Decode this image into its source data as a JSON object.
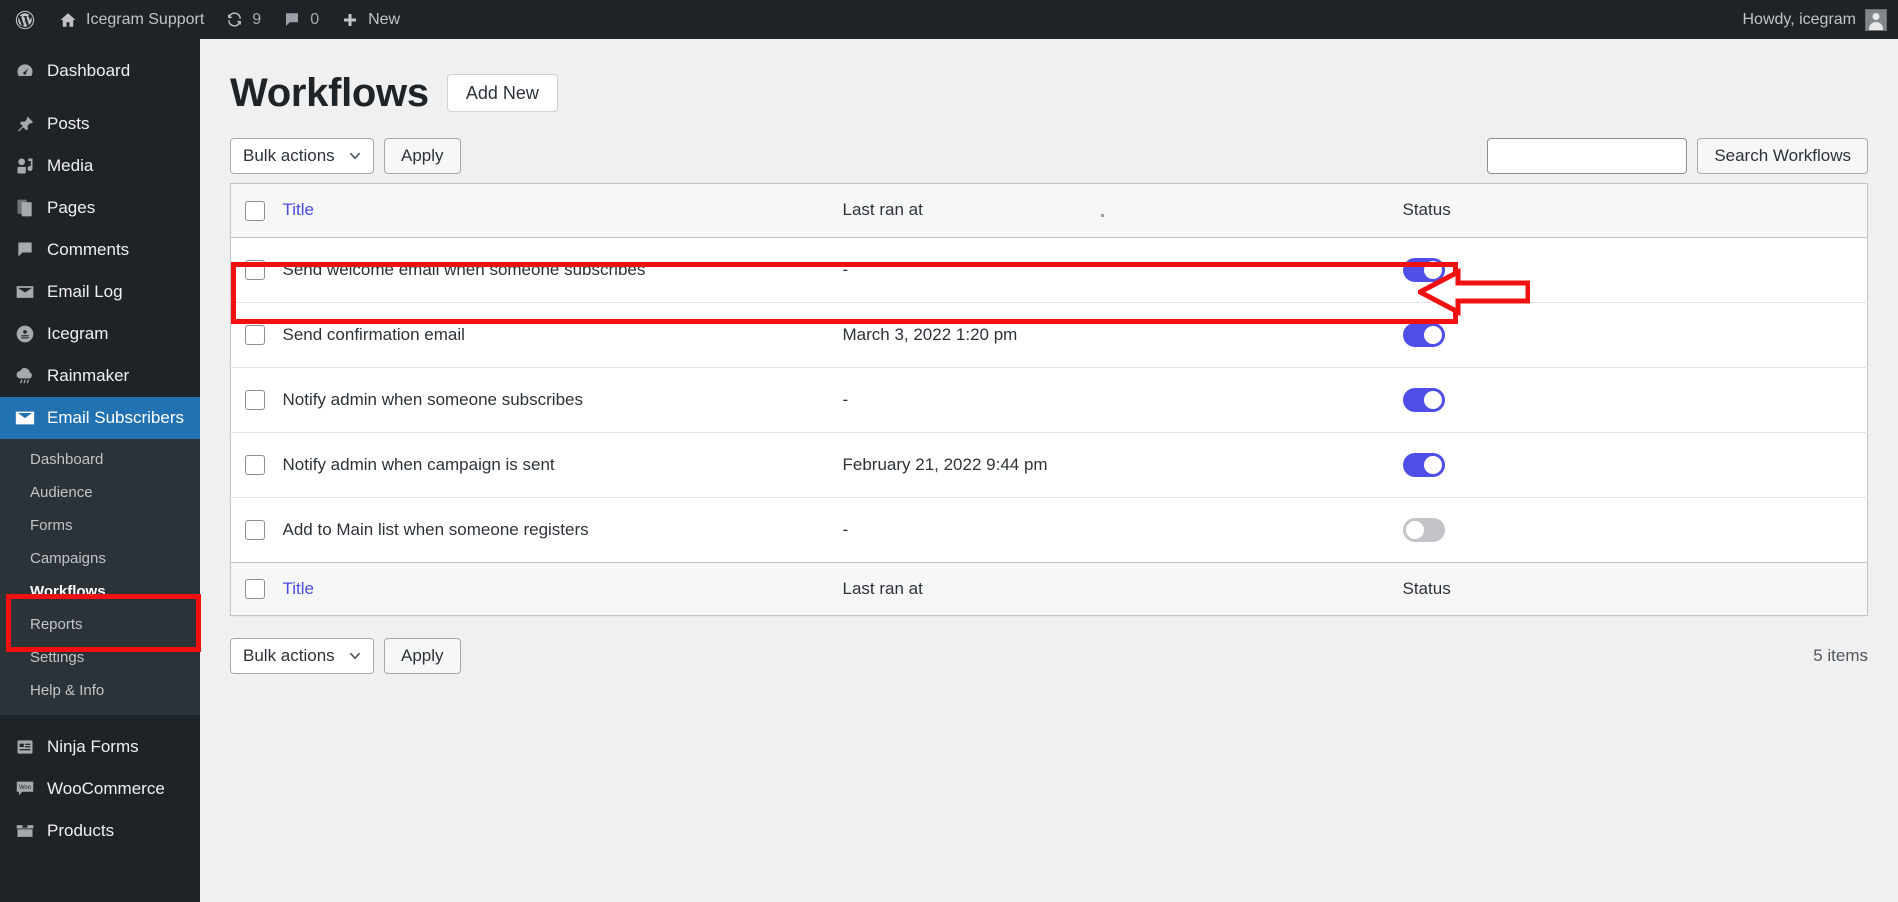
{
  "adminbar": {
    "logo_icon": "wordpress-logo-icon",
    "site_name": "Icegram Support",
    "site_icon": "home-icon",
    "updates_icon": "updates-icon",
    "updates_count": "9",
    "comments_icon": "comment-bubble-icon",
    "comments_count": "0",
    "new_icon": "plus-icon",
    "new_label": "New",
    "howdy": "Howdy, icegram",
    "avatar_icon": "user-avatar-icon"
  },
  "sidebar": {
    "items": [
      {
        "label": "Dashboard",
        "icon": "dashboard-icon",
        "current": false
      },
      {
        "label": "Posts",
        "icon": "pin-icon",
        "current": false
      },
      {
        "label": "Media",
        "icon": "media-icon",
        "current": false
      },
      {
        "label": "Pages",
        "icon": "pages-icon",
        "current": false
      },
      {
        "label": "Comments",
        "icon": "comments-icon",
        "current": false
      },
      {
        "label": "Email Log",
        "icon": "envelope-icon",
        "current": false
      },
      {
        "label": "Icegram",
        "icon": "icegram-icon",
        "current": false
      },
      {
        "label": "Rainmaker",
        "icon": "cloud-rain-icon",
        "current": false
      },
      {
        "label": "Email Subscribers",
        "icon": "mail-icon",
        "current": true
      },
      {
        "label": "Ninja Forms",
        "icon": "ninja-forms-icon",
        "current": false
      },
      {
        "label": "WooCommerce",
        "icon": "woocommerce-icon",
        "current": false
      },
      {
        "label": "Products",
        "icon": "products-icon",
        "current": false
      }
    ],
    "submenu": [
      {
        "label": "Dashboard",
        "current": false
      },
      {
        "label": "Audience",
        "current": false
      },
      {
        "label": "Forms",
        "current": false
      },
      {
        "label": "Campaigns",
        "current": false
      },
      {
        "label": "Workflows",
        "current": true
      },
      {
        "label": "Reports",
        "current": false
      },
      {
        "label": "Settings",
        "current": false
      },
      {
        "label": "Help & Info",
        "current": false
      }
    ]
  },
  "page": {
    "title": "Workflows",
    "add_new_label": "Add New"
  },
  "toolbar_top": {
    "bulk_actions_selected": "Bulk actions",
    "bulk_actions_options": [
      "Bulk actions"
    ],
    "apply_label": "Apply",
    "search_value": "",
    "search_placeholder": "",
    "search_button_label": "Search Workflows",
    "chevron_icon": "chevron-down-icon"
  },
  "toolbar_bottom": {
    "bulk_actions_selected": "Bulk actions",
    "apply_label": "Apply",
    "items_count": "5 items"
  },
  "table": {
    "columns": {
      "title": "Title",
      "last_ran_at": "Last ran at",
      "status": "Status"
    },
    "rows": [
      {
        "title": "Send welcome email when someone subscribes",
        "last_ran_at": "-",
        "status_on": true
      },
      {
        "title": "Send confirmation email",
        "last_ran_at": "March 3, 2022 1:20 pm",
        "status_on": true
      },
      {
        "title": "Notify admin when someone subscribes",
        "last_ran_at": "-",
        "status_on": true
      },
      {
        "title": "Notify admin when campaign is sent",
        "last_ran_at": "February 21, 2022 9:44 pm",
        "status_on": true
      },
      {
        "title": "Add to Main list when someone registers",
        "last_ran_at": "-",
        "status_on": false
      }
    ]
  },
  "annotations": {
    "highlight_color": "#f11010",
    "arrow_icon": "left-arrow-annotation-icon"
  },
  "colors": {
    "admin_dark": "#1d2327",
    "submenu_dark": "#2c3338",
    "current_blue": "#2271b1",
    "toggle_on": "#4f4fe8",
    "toggle_off": "#c3c4c7",
    "link_blue": "#4b4bdc",
    "page_bg": "#f0f0f1"
  }
}
